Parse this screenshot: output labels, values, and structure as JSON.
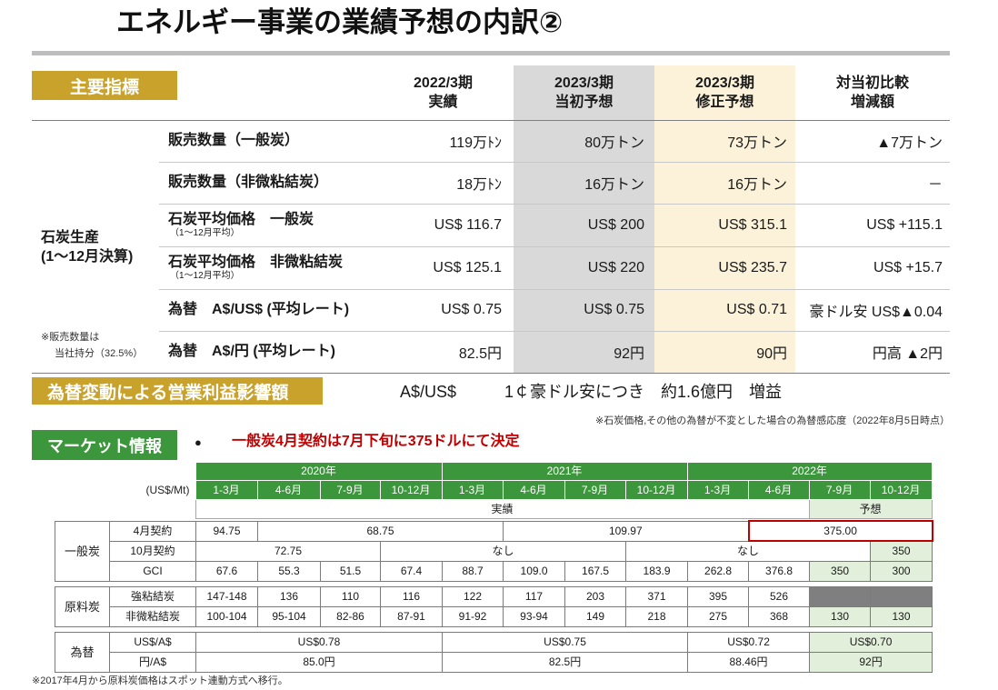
{
  "title": "エネルギー事業の業績予想の内訳②",
  "colors": {
    "gold": "#c9a22c",
    "green": "#3c963c",
    "forecast": "#e2efda",
    "initial": "#d9d9d9",
    "revised": "#fcf2da",
    "highlight": "#c00000",
    "unavailable": "#7f7f7f"
  },
  "kpi": {
    "section_label": "主要指標",
    "columns": [
      {
        "line1": "2022/3期",
        "line2": "実績"
      },
      {
        "line1": "2023/3期",
        "line2": "当初予想"
      },
      {
        "line1": "2023/3期",
        "line2": "修正予想"
      },
      {
        "line1": "対当初比較",
        "line2": "増減額"
      }
    ],
    "group_label_line1": "石炭生産",
    "group_label_line2": "(1〜12月決算)",
    "note_line1": "※販売数量は",
    "note_line2": "当社持分（32.5%）",
    "rows": [
      {
        "label": "販売数量（一般炭）",
        "values": [
          "119万ﾄﾝ",
          "80万トン",
          "73万トン",
          "▲7万トン"
        ]
      },
      {
        "label": "販売数量（非微粘結炭）",
        "values": [
          "18万ﾄﾝ",
          "16万トン",
          "16万トン",
          "－"
        ]
      },
      {
        "label": "石炭平均価格　一般炭",
        "sub": "（1〜12月平均）",
        "values": [
          "US$ 116.7",
          "US$ 200",
          "US$ 315.1",
          "US$ +115.1"
        ]
      },
      {
        "label": "石炭平均価格　非微粘結炭",
        "sub": "（1〜12月平均）",
        "values": [
          "US$ 125.1",
          "US$ 220",
          "US$ 235.7",
          "US$ +15.7"
        ]
      },
      {
        "label": "為替　A$/US$ (平均レート)",
        "values": [
          "US$ 0.75",
          "US$ 0.75",
          "US$ 0.71",
          "豪ドル安 US$▲0.04"
        ]
      },
      {
        "label": "為替　A$/円 (平均レート)",
        "values": [
          "82.5円",
          "92円",
          "90円",
          "円高 ▲2円"
        ]
      }
    ]
  },
  "fx_impact": {
    "label": "為替変動による営業利益影響額",
    "pair": "A$/US$",
    "text": "1￠豪ドル安につき　約1.6億円　増益",
    "note": "※石炭価格,その他の為替が不変とした場合の為替感応度（2022年8月5日時点）"
  },
  "market": {
    "section_label": "マーケット情報",
    "bullet": "●",
    "headline": "一般炭4月契約は7月下旬に375ドルにて決定",
    "unit": "(US$/Mt)",
    "years": [
      "2020年",
      "2021年",
      "2022年"
    ],
    "quarters": [
      "1-3月",
      "4-6月",
      "7-9月",
      "10-12月",
      "1-3月",
      "4-6月",
      "7-9月",
      "10-12月",
      "1-3月",
      "4-6月",
      "7-9月",
      "10-12月"
    ],
    "actual_label": "実績",
    "forecast_label": "予想",
    "thermal": {
      "label": "一般炭",
      "april_contract": {
        "label": "4月契約",
        "values": [
          "94.75",
          "68.75",
          "109.97",
          "375.00"
        ]
      },
      "october_contract": {
        "label": "10月契約",
        "values": [
          "72.75",
          "なし",
          "なし",
          "350"
        ]
      },
      "gci": {
        "label": "GCI",
        "values": [
          "67.6",
          "55.3",
          "51.5",
          "67.4",
          "88.7",
          "109.0",
          "167.5",
          "183.9",
          "262.8",
          "376.8",
          "350",
          "300"
        ]
      }
    },
    "coking": {
      "label": "原料炭",
      "hard": {
        "label": "強粘結炭",
        "values": [
          "147-148",
          "136",
          "110",
          "116",
          "122",
          "117",
          "203",
          "371",
          "395",
          "526"
        ]
      },
      "semi_soft": {
        "label": "非微粘結炭",
        "values": [
          "100-104",
          "95-104",
          "82-86",
          "87-91",
          "91-92",
          "93-94",
          "149",
          "218",
          "275",
          "368",
          "130",
          "130"
        ]
      }
    },
    "fx": {
      "label": "為替",
      "usd_per_aud": {
        "label": "US$/A$",
        "values": [
          "US$0.78",
          "US$0.75",
          "US$0.72",
          "US$0.70"
        ]
      },
      "jpy_per_aud": {
        "label": "円/A$",
        "values": [
          "85.0円",
          "82.5円",
          "88.46円",
          "92円"
        ]
      }
    },
    "footnote": "※2017年4月から原料炭価格はスポット連動方式へ移行。"
  }
}
